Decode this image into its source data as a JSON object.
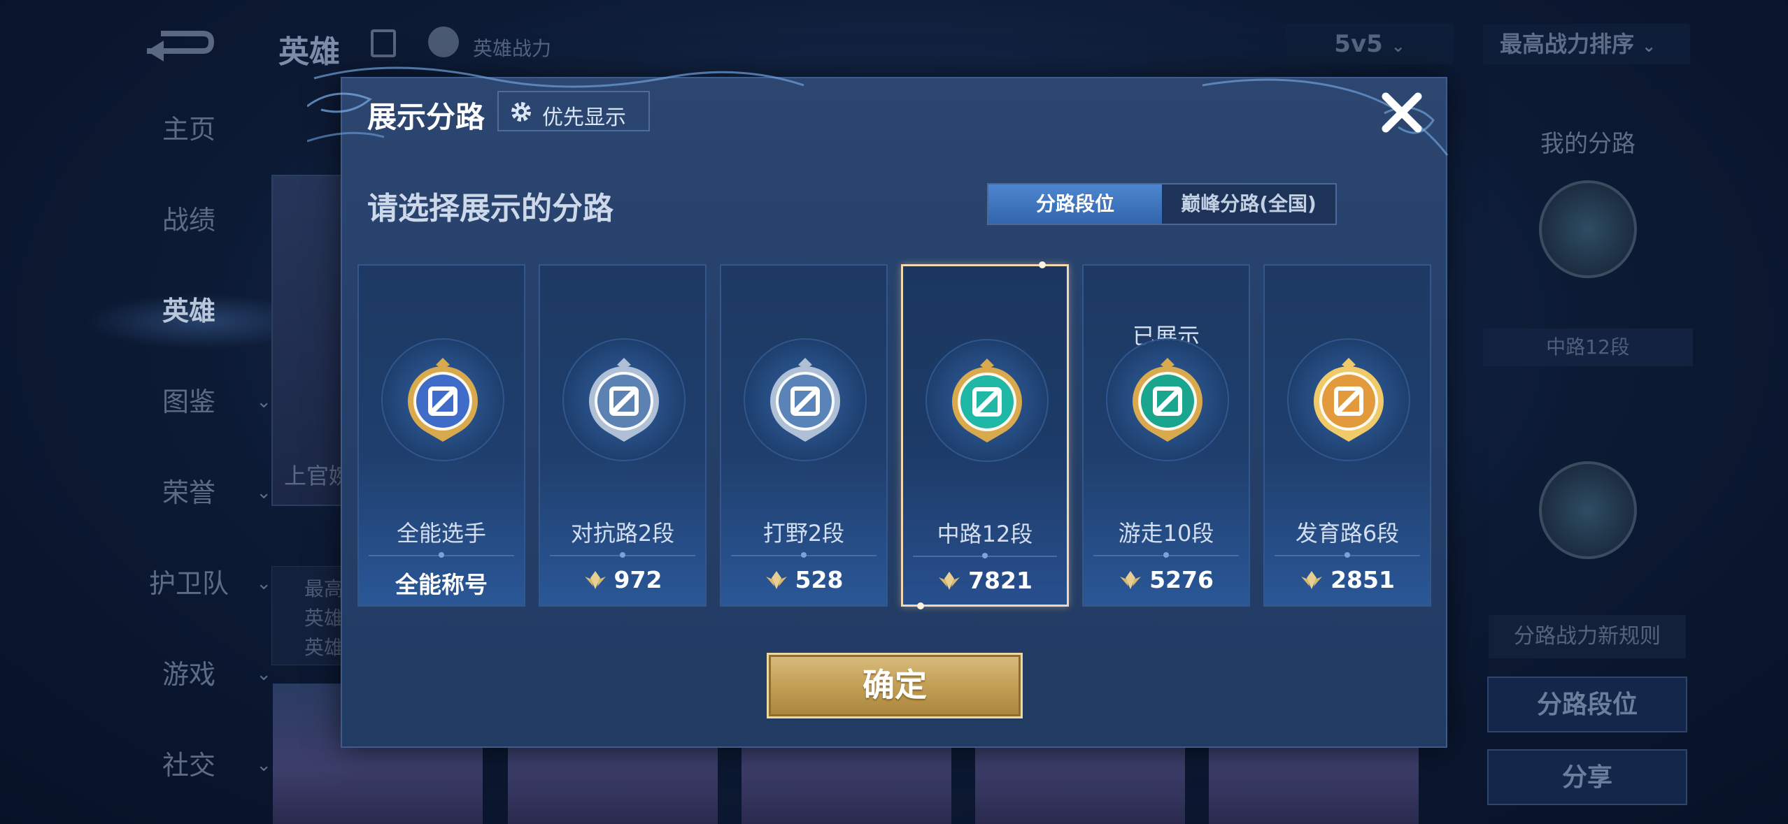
{
  "background": {
    "title": "英雄",
    "power_label": "英雄战力",
    "mode": "5v5",
    "sort": "最高战力排序",
    "nav": [
      {
        "label": "主页",
        "chev": ""
      },
      {
        "label": "战绩",
        "chev": ""
      },
      {
        "label": "英雄",
        "chev": "",
        "active": true
      },
      {
        "label": "图鉴",
        "chev": "⌄"
      },
      {
        "label": "荣誉",
        "chev": "⌄"
      },
      {
        "label": "护卫队",
        "chev": "⌄"
      },
      {
        "label": "游戏",
        "chev": "⌄"
      },
      {
        "label": "社交",
        "chev": "⌄"
      }
    ],
    "hero_name_partial": "上官婉",
    "hero_info_lines": [
      "最高",
      "英雄",
      "英雄"
    ],
    "right_panel": {
      "title": "我的分路",
      "lane_label": "中路12段",
      "rule_button": "分路战力新规则",
      "lane_rank_button": "分路段位",
      "share_button": "分享"
    }
  },
  "modal": {
    "title": "展示分路",
    "priority_button": "优先显示",
    "subtitle": "请选择展示的分路",
    "tabs": [
      "分路段位",
      "巅峰分路(全国)"
    ],
    "active_tab": 0,
    "confirm_button": "确定",
    "cards": [
      {
        "name": "全能选手",
        "value": "全能称号",
        "show_icon": false,
        "shown_label": "",
        "badge": "allround-badge",
        "badge_color": "#3f6cc8",
        "rim": "#d9a94e"
      },
      {
        "name": "对抗路2段",
        "value": "972",
        "show_icon": true,
        "shown_label": "",
        "badge": "clash-lane-badge",
        "badge_color": "#5c82b4",
        "rim": "#aebfd6"
      },
      {
        "name": "打野2段",
        "value": "528",
        "show_icon": true,
        "shown_label": "",
        "badge": "jungle-badge",
        "badge_color": "#5a84b8",
        "rim": "#aebfd6"
      },
      {
        "name": "中路12段",
        "value": "7821",
        "show_icon": true,
        "shown_label": "",
        "badge": "mid-lane-badge",
        "badge_color": "#1fb8a6",
        "rim": "#d9a94e",
        "selected": true
      },
      {
        "name": "游走10段",
        "value": "5276",
        "show_icon": true,
        "shown_label": "已展示",
        "badge": "roam-badge",
        "badge_color": "#1aa58f",
        "rim": "#d9a94e"
      },
      {
        "name": "发育路6段",
        "value": "2851",
        "show_icon": true,
        "shown_label": "",
        "badge": "farm-lane-badge",
        "badge_color": "#e29a3c",
        "rim": "#f0c968"
      }
    ]
  },
  "colors": {
    "gold": "#d9a94e",
    "accent_blue": "#3f7ac4",
    "selected_border": "#f3d7b0"
  }
}
